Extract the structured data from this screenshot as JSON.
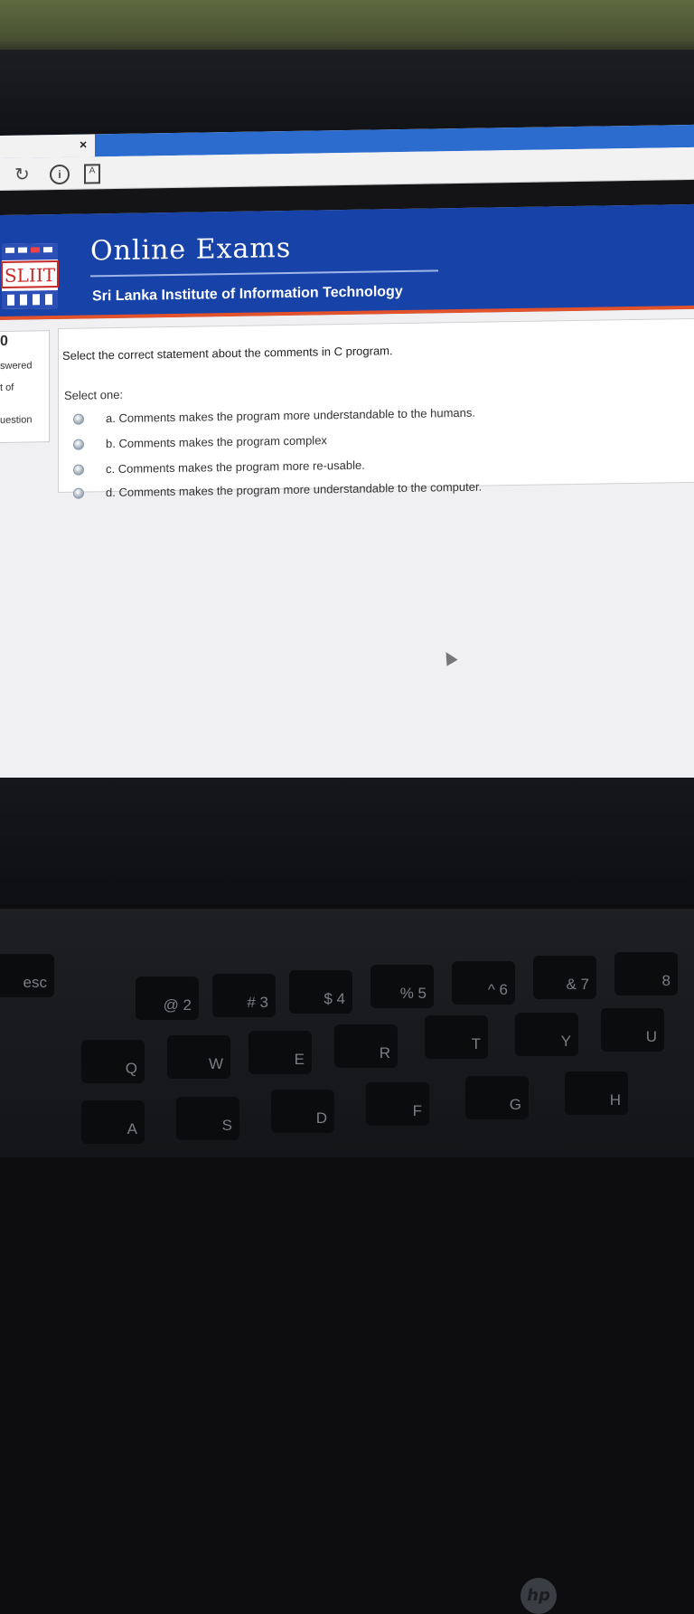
{
  "browser": {
    "tab_close_glyph": "×",
    "toolbar_icons": [
      "back-arrow-icon",
      "reload-icon",
      "info-icon",
      "document-icon"
    ]
  },
  "site": {
    "logo_text": "SLIIT",
    "title": "Online Exams",
    "subtitle": "Sri Lanka Institute of Information Technology",
    "header_color": "#1742a8",
    "accent_color": "#e2522b"
  },
  "question_info": {
    "number": "0",
    "status": "swered",
    "marks": "t of",
    "flag": "uestion"
  },
  "question": {
    "text": "Select the correct statement about the comments in C program.",
    "prompt": "Select one:",
    "options": [
      {
        "label": "a. Comments makes the program more understandable to the humans."
      },
      {
        "label": "b. Comments makes the program complex"
      },
      {
        "label": "c. Comments makes the program more re-usable."
      },
      {
        "label": "d. Comments makes the program more understandable to the computer."
      }
    ]
  },
  "laptop": {
    "brand_logo": "hp",
    "keys": [
      "esc",
      "@ 2",
      "# 3",
      "$ 4",
      "% 5",
      "^ 6",
      "& 7",
      "8",
      "Q",
      "W",
      "E",
      "R",
      "T",
      "Y",
      "U",
      "A",
      "S",
      "D",
      "F",
      "G",
      "H"
    ]
  }
}
